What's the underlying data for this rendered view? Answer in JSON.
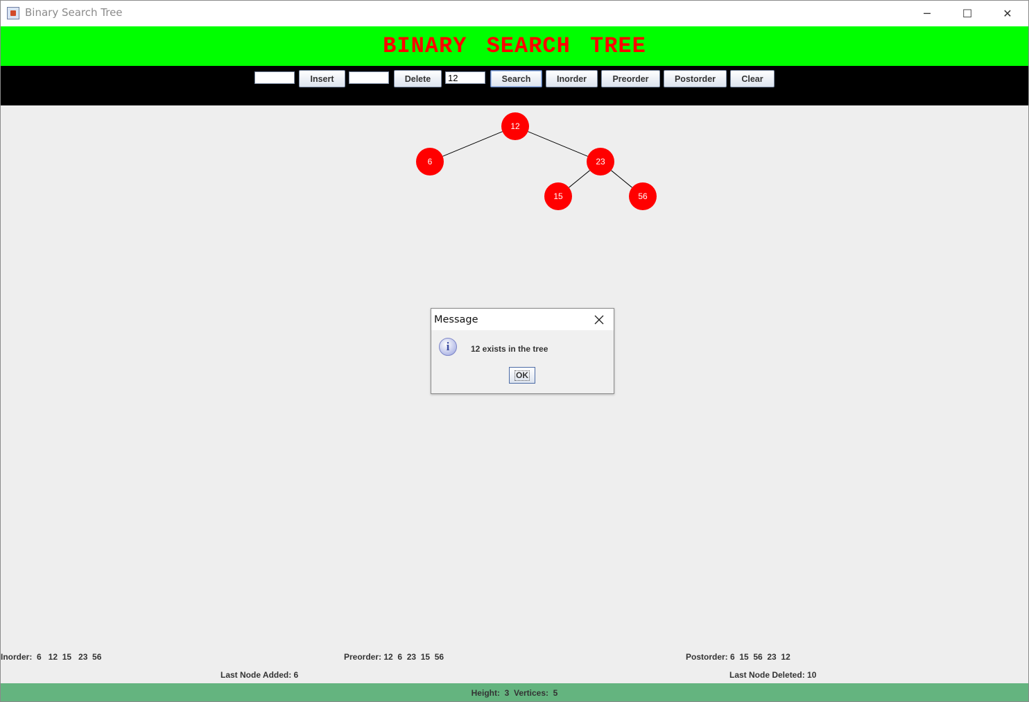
{
  "window": {
    "title": "Binary Search Tree",
    "controls": {
      "minimize": "─",
      "maximize": "☐",
      "close": "✕"
    }
  },
  "banner": {
    "title": "BINARY SEARCH TREE",
    "bg_color": "#00ff00",
    "text_color": "#ff0000"
  },
  "toolbar": {
    "insert_value": "",
    "insert_label": "Insert",
    "delete_value": "",
    "delete_label": "Delete",
    "search_value": "12",
    "search_label": "Search",
    "inorder_label": "Inorder",
    "preorder_label": "Preorder",
    "postorder_label": "Postorder",
    "clear_label": "Clear"
  },
  "tree": {
    "node_color": "#ff0000",
    "nodes": [
      {
        "id": "n12",
        "label": "12"
      },
      {
        "id": "n6",
        "label": "6"
      },
      {
        "id": "n23",
        "label": "23"
      },
      {
        "id": "n15",
        "label": "15"
      },
      {
        "id": "n56",
        "label": "56"
      }
    ],
    "edges": [
      [
        "n12",
        "n6"
      ],
      [
        "n12",
        "n23"
      ],
      [
        "n23",
        "n15"
      ],
      [
        "n23",
        "n56"
      ]
    ]
  },
  "traversals": {
    "inorder": "Inorder:  6   12  15   23  56",
    "preorder": "Preorder: 12  6  23  15  56",
    "postorder": "Postorder: 6  15  56  23  12",
    "last_added": "Last Node Added: 6",
    "last_deleted": "Last Node Deleted: 10"
  },
  "status": {
    "text": "Height:  3  Vertices:  5",
    "bg_color": "#64b47f"
  },
  "dialog": {
    "title": "Message",
    "message": "12 exists in the tree",
    "ok_label": "OK",
    "icon": "info-icon"
  }
}
